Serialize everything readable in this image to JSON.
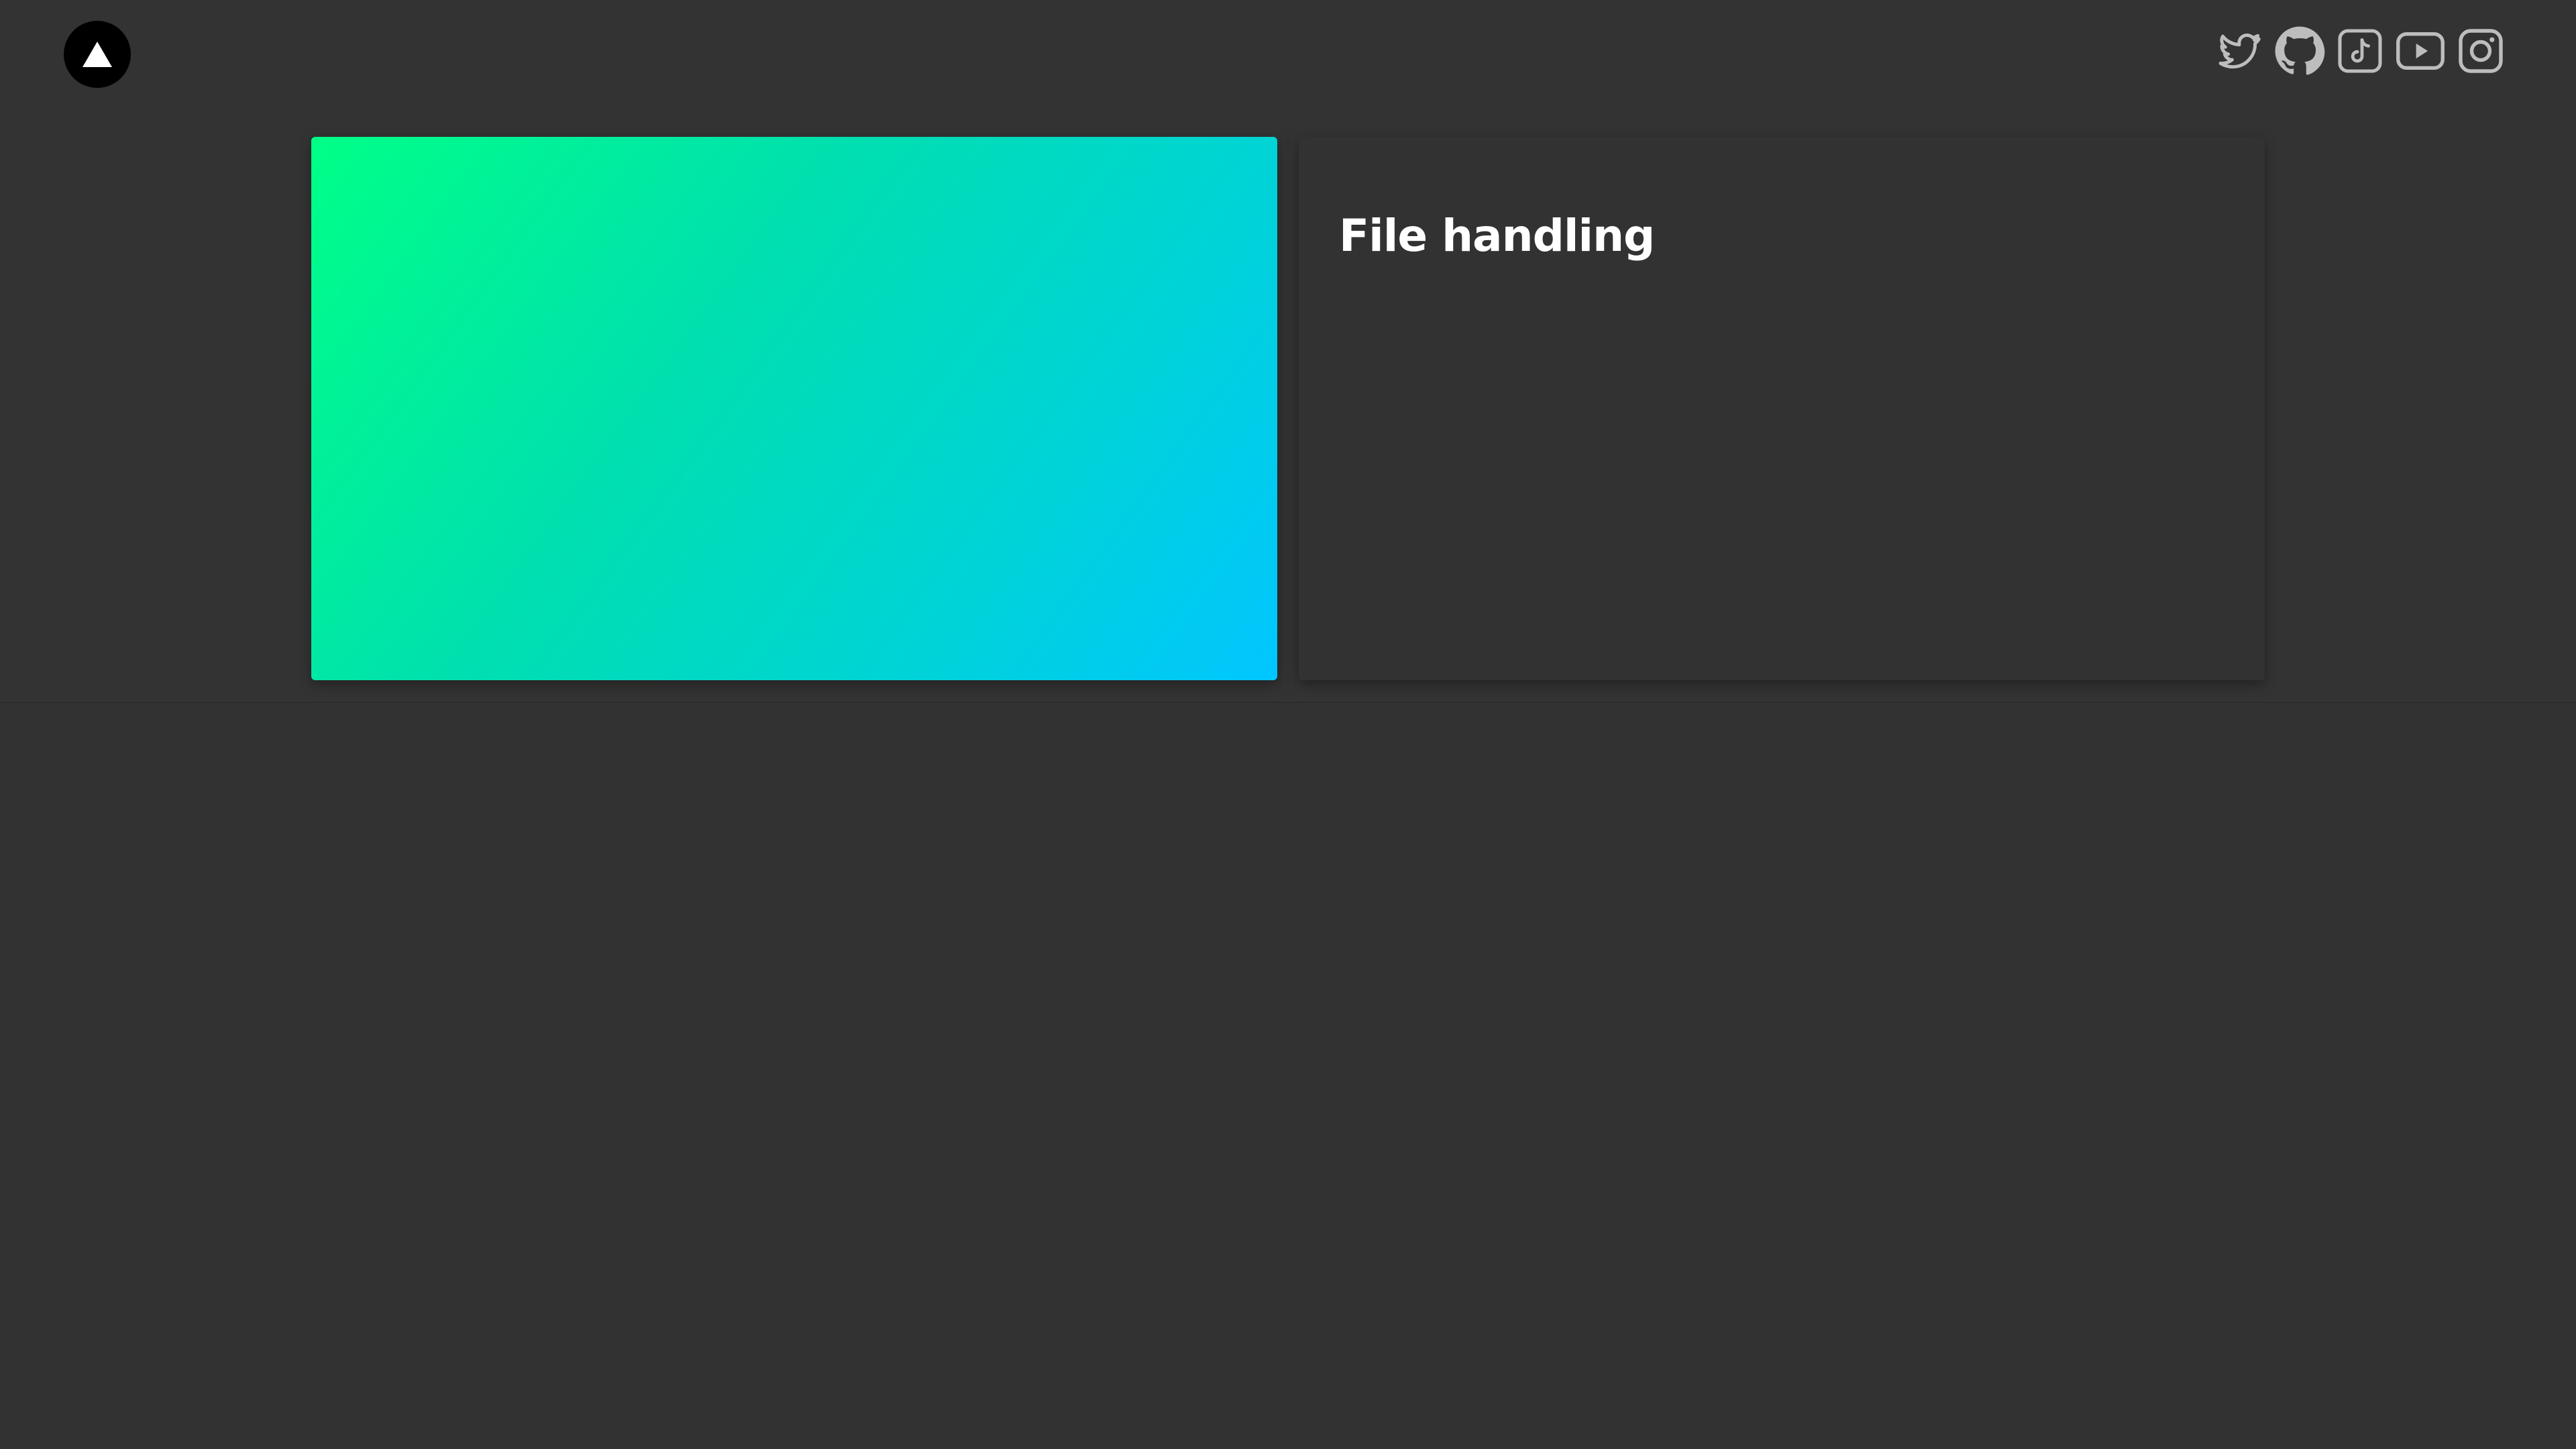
{
  "header": {
    "logo_icon": "triangle-logo-icon",
    "social_links": [
      {
        "name": "twitter",
        "icon": "twitter-icon"
      },
      {
        "name": "github",
        "icon": "github-icon"
      },
      {
        "name": "tiktok",
        "icon": "tiktok-icon"
      },
      {
        "name": "youtube",
        "icon": "youtube-icon"
      },
      {
        "name": "instagram",
        "icon": "instagram-icon"
      }
    ]
  },
  "project": {
    "title": "File handling",
    "gradient_colors": [
      "#00ff87",
      "#00c6ff"
    ]
  },
  "colors": {
    "background": "#323232",
    "icon": "#bdbdbd",
    "title_text": "#ffffff"
  }
}
